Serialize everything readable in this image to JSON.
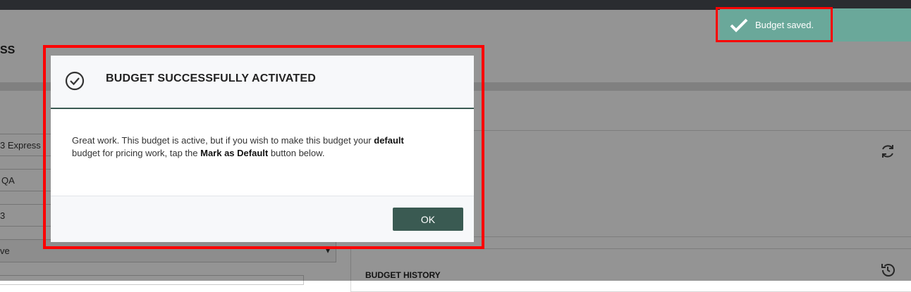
{
  "background": {
    "page_title": "SS",
    "fields": [
      "3 Express",
      "QA",
      "3"
    ],
    "select_value": "ve",
    "history_title": "BUDGET HISTORY",
    "refresh_icon": "refresh-icon",
    "history_icon": "history-icon"
  },
  "toast": {
    "icon": "checkmark-icon",
    "message": "Budget saved."
  },
  "dialog": {
    "icon": "check-circle-icon",
    "title": "BUDGET SUCCESSFULLY ACTIVATED",
    "body_part1": "Great work. This budget is active, but if you wish to make this budget your ",
    "body_bold1": "default",
    "body_part2": " budget for pricing work, tap the ",
    "body_bold2": "Mark as Default",
    "body_part3": " button below.",
    "ok_label": "OK"
  },
  "colors": {
    "accent": "#3a5a52",
    "toast": "#6aa89a",
    "highlight": "#ff0000"
  }
}
